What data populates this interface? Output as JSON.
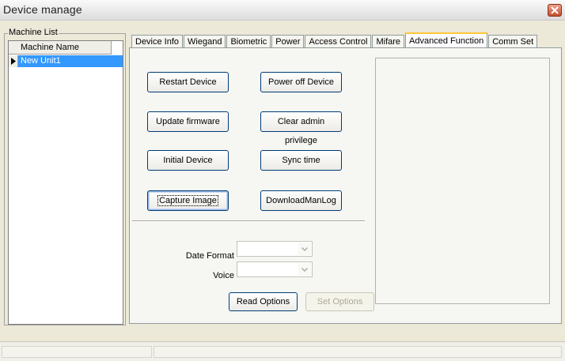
{
  "window": {
    "title": "Device manage"
  },
  "machine_list": {
    "group_label": "Machine List",
    "column_header": "Machine Name",
    "rows": [
      {
        "name": "New Unit1",
        "selected": true
      }
    ]
  },
  "tabs": [
    {
      "label": "Device Info",
      "active": false
    },
    {
      "label": "Wiegand",
      "active": false
    },
    {
      "label": "Biometric",
      "active": false
    },
    {
      "label": "Power",
      "active": false
    },
    {
      "label": "Access Control",
      "active": false
    },
    {
      "label": "Mifare",
      "active": false
    },
    {
      "label": "Advanced Function",
      "active": true
    },
    {
      "label": "Comm Set",
      "active": false
    }
  ],
  "advanced": {
    "restart_label": "Restart Device",
    "power_off_label": "Power off Device",
    "update_firmware_label": "Update firmware",
    "clear_admin_label": "Clear admin privilege",
    "initial_device_label": "Initial Device",
    "sync_time_label": "Sync time",
    "capture_image_label": "Capture Image",
    "download_manlog_label": "DownloadManLog",
    "date_format_label": "Date Format",
    "date_format_value": "",
    "voice_label": "Voice",
    "voice_value": "",
    "read_options_label": "Read Options",
    "set_options_label": "Set Options"
  },
  "colors": {
    "selection": "#3399ff",
    "active_tab_accent": "#ffc83c",
    "button_border": "#003c74"
  }
}
